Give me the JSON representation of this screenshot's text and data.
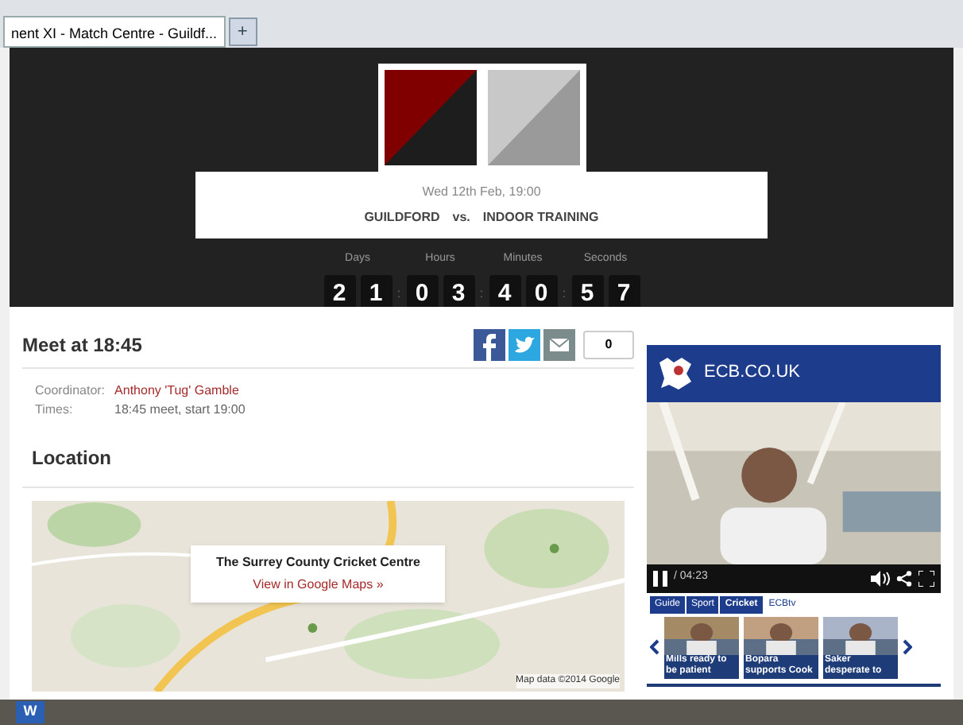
{
  "browser": {
    "tabs": [
      {
        "label": "nent XI - Match Centre - Guildf...",
        "selected": true
      }
    ],
    "new_tab": "+"
  },
  "match": {
    "date": "Wed 12th Feb, 19:00",
    "home": "GUILDFORD",
    "vs": "vs.",
    "away": "INDOOR TRAINING",
    "countdown": [
      {
        "label": "Days",
        "digits": [
          "2",
          "1"
        ]
      },
      {
        "label": "Hours",
        "digits": [
          "0",
          "3"
        ]
      },
      {
        "label": "Minutes",
        "digits": [
          "4",
          "0"
        ]
      },
      {
        "label": "Seconds",
        "digits": [
          "5",
          "7"
        ]
      }
    ],
    "separator": ":"
  },
  "meet": {
    "title": "Meet at 18:45",
    "share_count": "0",
    "details": [
      {
        "label": "Coordinator:",
        "value": "Anthony 'Tug' Gamble",
        "kind": "link"
      },
      {
        "label": "Times:",
        "value": "18:45 meet, start 19:00",
        "kind": "text"
      }
    ]
  },
  "location": {
    "title": "Location",
    "venue": "The Surrey County Cricket Centre",
    "map_link": "View in Google Maps »",
    "attribution": "Map data ©2014 Google"
  },
  "video_widget": {
    "brand": "ECB.CO.UK",
    "duration": "/ 04:23",
    "breadcrumbs": [
      {
        "label": "Guide",
        "selected": false
      },
      {
        "label": "Sport",
        "selected": false
      },
      {
        "label": "Cricket",
        "selected": true
      },
      {
        "label": "ECBtv",
        "selected": false
      }
    ],
    "thumbnails": [
      {
        "caption": "Mills ready to be patient"
      },
      {
        "caption": "Bopara supports Cook"
      },
      {
        "caption": "Saker desperate to"
      }
    ]
  },
  "taskbar": {
    "apps": [
      {
        "label": "W"
      }
    ]
  }
}
